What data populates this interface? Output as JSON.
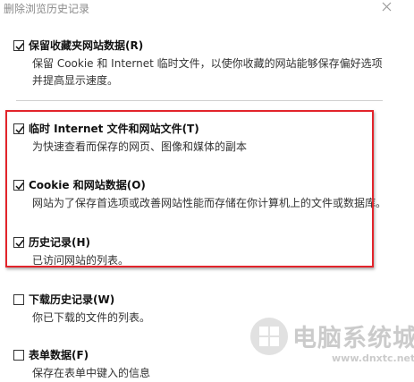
{
  "window": {
    "title": "删除浏览历史记录",
    "close_icon": "close-icon"
  },
  "options": [
    {
      "label": "保留收藏夹网站数据(R)",
      "description": "保留 Cookie 和 Internet 临时文件，以使你收藏的网站能够保存偏好选项并提高显示速度。",
      "checked": true
    },
    {
      "label": "临时 Internet 文件和网站文件(T)",
      "description": "为快速查看而保存的网页、图像和媒体的副本",
      "checked": true
    },
    {
      "label": "Cookie 和网站数据(O)",
      "description": "网站为了保存首选项或改善网站性能而存储在你计算机上的文件或数据库。",
      "checked": true
    },
    {
      "label": "历史记录(H)",
      "description": "已访问网站的列表。",
      "checked": true
    },
    {
      "label": "下载历史记录(W)",
      "description": "你已下载的文件的列表。",
      "checked": false
    },
    {
      "label": "表单数据(F)",
      "description": "保存在表单中键入的信息",
      "checked": false
    }
  ],
  "highlight_color": "#e2242b",
  "watermark": {
    "text": "电脑系统城",
    "url": "www.dnxtc.net"
  }
}
